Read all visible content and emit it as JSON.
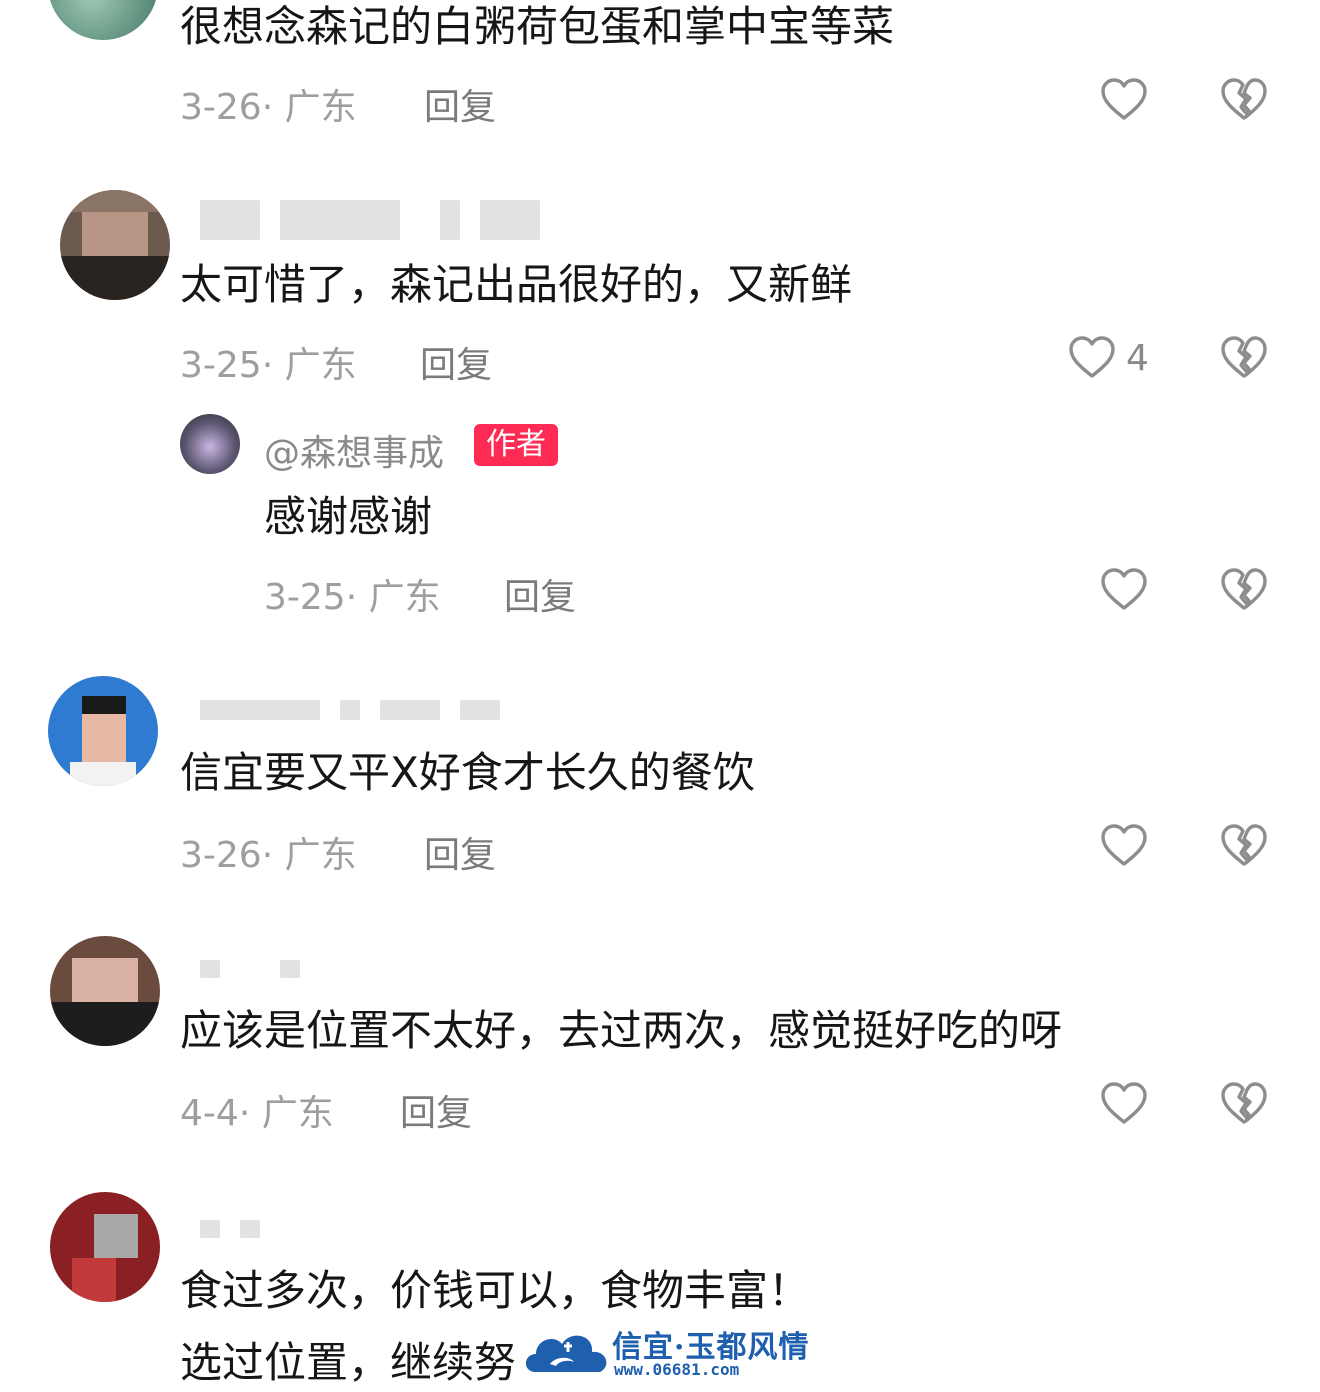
{
  "colors": {
    "author_badge": "#fe2c55",
    "meta_text": "#9e9e9e",
    "body_text": "#161616",
    "watermark": "#1e5fae"
  },
  "comments": [
    {
      "text": "很想念森记的白粥荷包蛋和掌中宝等菜",
      "date": "3-26",
      "location": "广东",
      "reply_label": "回复",
      "like_icon": "heart-outline-icon",
      "dislike_icon": "broken-heart-icon"
    },
    {
      "text": "太可惜了，森记出品很好的，又新鲜",
      "date": "3-25",
      "location": "广东",
      "reply_label": "回复",
      "like_count": "4",
      "like_icon": "heart-outline-icon",
      "dislike_icon": "broken-heart-icon",
      "reply": {
        "handle": "@森想事成",
        "badge": "作者",
        "text": "感谢感谢",
        "date": "3-25",
        "location": "广东",
        "reply_label": "回复"
      }
    },
    {
      "text": "信宜要又平X好食才长久的餐饮",
      "date": "3-26",
      "location": "广东",
      "reply_label": "回复",
      "like_icon": "heart-outline-icon",
      "dislike_icon": "broken-heart-icon"
    },
    {
      "text": "应该是位置不太好，去过两次，感觉挺好吃的呀",
      "date": "4-4",
      "location": "广东",
      "reply_label": "回复",
      "like_icon": "heart-outline-icon",
      "dislike_icon": "broken-heart-icon"
    },
    {
      "text_line1": "食过多次，价钱可以，食物丰富！",
      "text_line2": "选过位置，继续努"
    }
  ],
  "watermark": {
    "title": "信宜·玉都风情",
    "url": "www.06681.com"
  }
}
